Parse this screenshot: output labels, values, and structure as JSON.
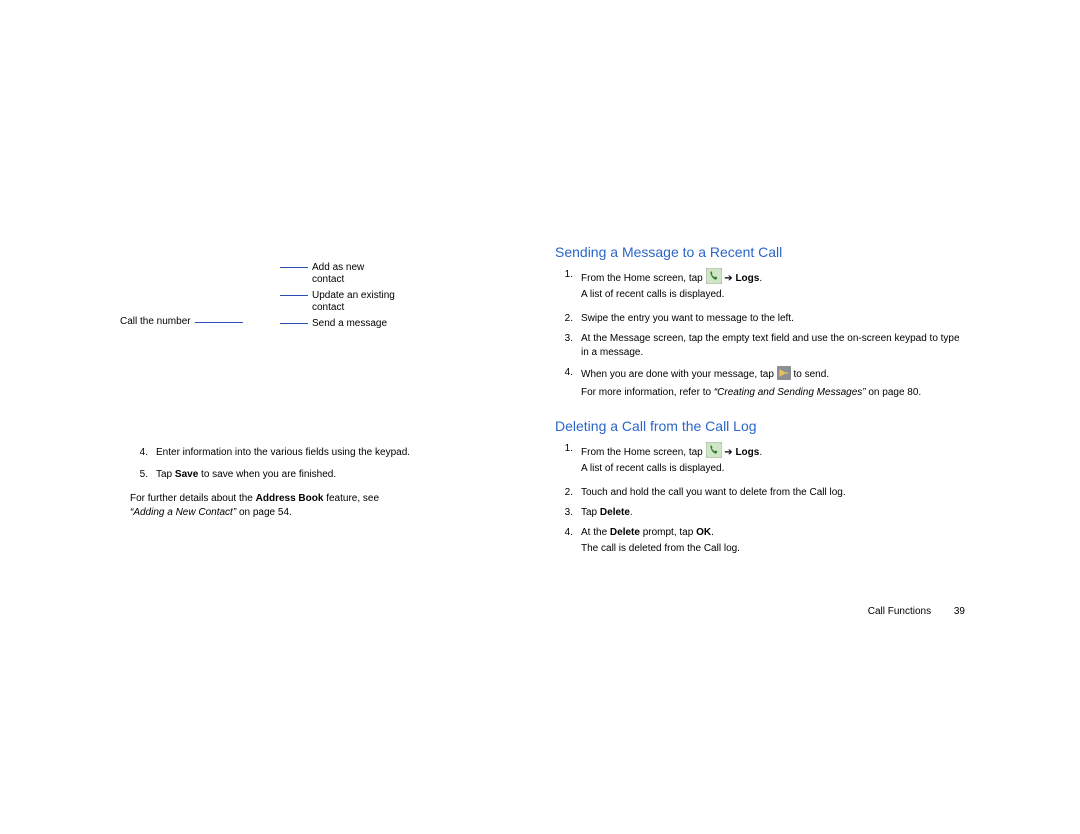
{
  "left_callouts": {
    "call_number": "Call the number",
    "add_new": "Add as new contact",
    "update_existing": "Update an existing contact",
    "send_message": "Send a message"
  },
  "left_steps": {
    "s4": "Enter information into the various fields using the keypad.",
    "s5_pre": "Tap ",
    "s5_bold": "Save",
    "s5_post": " to save when you are finished."
  },
  "left_further": {
    "pre": "For further details about the ",
    "bold": "Address Book",
    "mid": " feature, see ",
    "italic": "“Adding a New Contact”",
    "post": " on page 54."
  },
  "right": {
    "heading1": "Sending a Message to a Recent Call",
    "sec1": {
      "s1_pre": "From the Home screen, tap ",
      "s1_arrow": " ➔ ",
      "s1_bold": "Logs",
      "s1_dot": ".",
      "s1_sub": "A list of recent calls is displayed.",
      "s2": "Swipe the entry you want to message to the left.",
      "s3": "At the Message screen, tap the empty text field and use the on-screen keypad to type in a message.",
      "s4_pre": "When you are done with your message, tap ",
      "s4_post": " to send.",
      "note_pre": "For more information, refer to ",
      "note_italic": "“Creating and Sending Messages”",
      "note_post": " on page 80."
    },
    "heading2": "Deleting a Call from the Call Log",
    "sec2": {
      "s1_pre": "From the Home screen, tap ",
      "s1_arrow": " ➔ ",
      "s1_bold": "Logs",
      "s1_dot": ".",
      "s1_sub": "A list of recent calls is displayed.",
      "s2": "Touch and hold the call you want to delete from the Call log.",
      "s3_pre": "Tap ",
      "s3_bold": "Delete",
      "s3_dot": ".",
      "s4_pre": "At the ",
      "s4_bold": "Delete",
      "s4_mid": " prompt, tap ",
      "s4_bold2": "OK",
      "s4_dot": ".",
      "s4_sub": "The call is deleted from the Call log."
    }
  },
  "footer": {
    "section": "Call Functions",
    "page": "39"
  },
  "numbers": {
    "n1": "1.",
    "n2": "2.",
    "n3": "3.",
    "n4": "4.",
    "n5": "5."
  }
}
